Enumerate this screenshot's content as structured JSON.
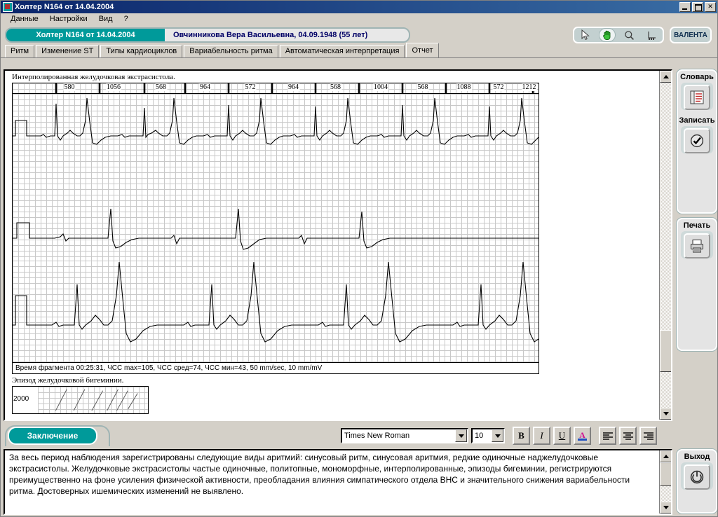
{
  "window": {
    "title": "Холтер  N164 от 14.04.2004",
    "icon": "holter-app-icon",
    "minimize": "_",
    "maximize": "□",
    "close": "✕"
  },
  "menu": {
    "items": [
      {
        "label": "Данные",
        "name": "menu-data"
      },
      {
        "label": "Настройки",
        "name": "menu-settings"
      },
      {
        "label": "Вид",
        "name": "menu-view"
      },
      {
        "label": "?",
        "name": "menu-help"
      }
    ]
  },
  "patient_bar": {
    "study_label": "Холтер  N164 от 14.04.2004",
    "patient_info": "Овчинникова Вера Васильевна,  04.09.1948  (55 лет)"
  },
  "toolbar": {
    "tools": [
      {
        "name": "arrow-cursor-icon",
        "glyph": "arrow",
        "active": false
      },
      {
        "name": "hand-pan-icon",
        "glyph": "hand",
        "active": true
      },
      {
        "name": "magnifier-zoom-icon",
        "glyph": "magnifier",
        "active": false
      },
      {
        "name": "measure-ruler-icon",
        "glyph": "ruler",
        "active": false
      }
    ],
    "brand": "ВАЛЕНТА"
  },
  "tabs": [
    {
      "label": "Ритм",
      "active": false
    },
    {
      "label": "Изменение ST",
      "active": false
    },
    {
      "label": "Типы кардиоциклов",
      "active": false
    },
    {
      "label": "Вариабельность ритма",
      "active": false
    },
    {
      "label": "Автоматическая интерпретация",
      "active": false
    },
    {
      "label": "Отчет",
      "active": true
    }
  ],
  "report": {
    "fragment1": {
      "caption": "Интерполированная желудочковая экстрасистола.",
      "rr_intervals": [
        580,
        1056,
        568,
        964,
        572,
        964,
        568,
        1004,
        568,
        1088,
        572,
        1212
      ],
      "footer": "Время фрагмента 00:25:31,  ЧСС max=105,  ЧСС сред=74,  ЧСС мин=43, 50 mm/sec, 10 mm/mV"
    },
    "fragment2": {
      "caption": "Эпизод желудочковой бигеминии.",
      "axis_label": "2000"
    }
  },
  "format_toolbar": {
    "conclusion_tab": "Заключение",
    "font_family": "Times New Roman",
    "font_size": "10",
    "buttons": [
      {
        "label": "B",
        "name": "bold-button"
      },
      {
        "label": "I",
        "name": "italic-button"
      },
      {
        "label": "U",
        "name": "underline-button"
      },
      {
        "label": "A",
        "name": "font-color-button"
      },
      {
        "label": "≡",
        "name": "align-left-button"
      },
      {
        "label": "≡",
        "name": "align-center-button"
      },
      {
        "label": "≡",
        "name": "align-right-button"
      }
    ]
  },
  "conclusion": {
    "text": "За весь период наблюдения зарегистрированы следующие виды аритмий: синусовый ритм, синусовая аритмия, редкие одиночные наджелудочковые экстрасистолы. Желудочковые экстрасистолы частые одиночные, политопные, мономорфные, интерполированные, эпизоды бигеминии, регистрируются преимущественно на фоне усиления физической активности, преобладания влияния симпатического отдела ВНС и значительного снижения вариабельности ритма. Достоверных ишемических изменений не выявлено."
  },
  "sidebar": {
    "groups": [
      {
        "items": [
          {
            "label": "Словарь",
            "icon": "dictionary-list-icon",
            "name": "dictionary-button"
          },
          {
            "label": "Записать",
            "icon": "save-check-icon",
            "name": "save-button"
          }
        ]
      },
      {
        "items": [
          {
            "label": "Печать",
            "icon": "printer-icon",
            "name": "print-button"
          }
        ]
      },
      {
        "items": [
          {
            "label": "Выход",
            "icon": "power-off-icon",
            "name": "exit-button"
          }
        ]
      }
    ]
  },
  "colors": {
    "accent_teal": "#009a9a",
    "title_blue": "#0a246a",
    "face": "#d4d0c8",
    "panel": "#e4e4e4"
  }
}
